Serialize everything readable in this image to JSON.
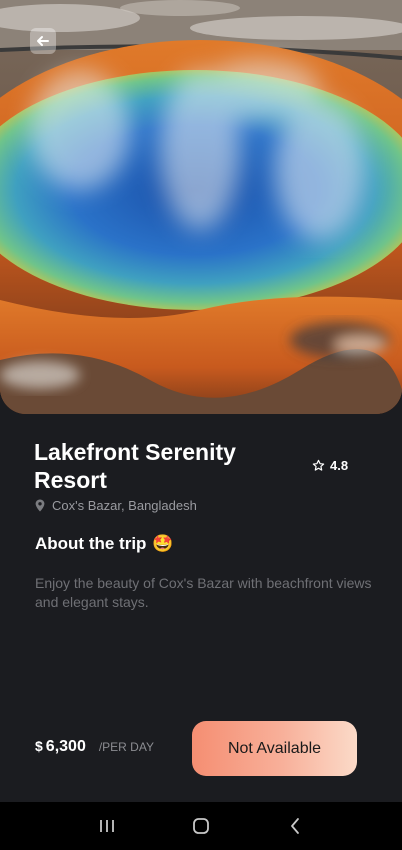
{
  "header": {
    "back_icon": "arrow-left-icon"
  },
  "resort": {
    "name": "Lakefront Serenity Resort",
    "rating": "4.8",
    "location": "Cox's Bazar, Bangladesh"
  },
  "about": {
    "heading": "About the trip",
    "emoji": "🤩",
    "description": "Enjoy the beauty of Cox's Bazar with beachfront views and elegant stays."
  },
  "footer": {
    "currency": "$",
    "price": "6,300",
    "period": "/PER DAY",
    "cta_label": "Not Available"
  },
  "system_nav": {
    "icons": [
      "recents-icon",
      "home-icon",
      "back-icon"
    ]
  },
  "colors": {
    "background": "#1b1c20",
    "cta_gradient_start": "#f58e72",
    "cta_gradient_end": "#fbdac8",
    "muted_text": "#6f7075"
  }
}
